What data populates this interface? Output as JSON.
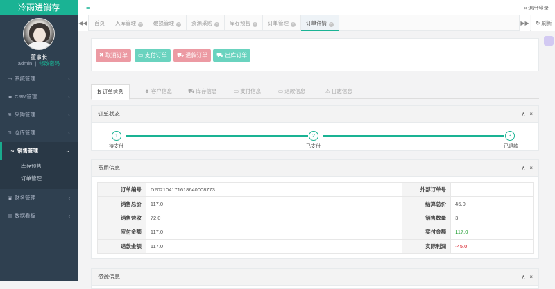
{
  "app": {
    "title": "冷雨进销存"
  },
  "user": {
    "role": "董事长",
    "name": "admin",
    "separator": "|",
    "change_password": "修改密码"
  },
  "sidebar": {
    "items": [
      {
        "label": "系统管理",
        "icon": "laptop-icon",
        "glyph": "▭"
      },
      {
        "label": "CRM管理",
        "icon": "users-icon",
        "glyph": "☻"
      },
      {
        "label": "采购管理",
        "icon": "cart-icon",
        "glyph": "⊞"
      },
      {
        "label": "仓库管理",
        "icon": "lock-icon",
        "glyph": "⊡"
      },
      {
        "label": "销售管理",
        "icon": "chart-line-icon",
        "glyph": "∿"
      },
      {
        "label": "财务管理",
        "icon": "money-icon",
        "glyph": "▣"
      },
      {
        "label": "数据看板",
        "icon": "bar-chart-icon",
        "glyph": "▥"
      }
    ],
    "sales_sub": [
      "库存预售",
      "订单管理"
    ]
  },
  "topbar": {
    "menu_icon": "≡",
    "logout": "退出登录",
    "logout_icon": "⇥"
  },
  "tabs": {
    "left_arrow": "◀◀",
    "items": [
      "首页",
      "入库管理",
      "破损管理",
      "资源采购",
      "库存预售",
      "订单管理",
      "订单详情"
    ],
    "active": "订单详情",
    "close_glyph": "×",
    "right_arrow": "▶▶",
    "refresh": "刷新",
    "refresh_glyph": "↻"
  },
  "actions": {
    "cancel": "取消订单",
    "cancel_glyph": "✖",
    "pay": "支付订单",
    "pay_glyph": "▭",
    "refund": "退款订单",
    "refund_glyph": "⛟",
    "outbound": "出库订单",
    "outbound_glyph": "⛟"
  },
  "subtabs": {
    "items": [
      {
        "label": "订单信息",
        "glyph": "₿"
      },
      {
        "label": "客户信息",
        "glyph": "☻"
      },
      {
        "label": "库存信息",
        "glyph": "⛟"
      },
      {
        "label": "支付信息",
        "glyph": "▭"
      },
      {
        "label": "退款信息",
        "glyph": "▭"
      },
      {
        "label": "日志信息",
        "glyph": "⚠"
      }
    ],
    "active": "订单信息"
  },
  "order_status": {
    "title": "订单状态",
    "steps": [
      {
        "num": "1",
        "label": "待支付"
      },
      {
        "num": "2",
        "label": "已支付"
      },
      {
        "num": "3",
        "label": "已退款"
      }
    ]
  },
  "panel_tools": {
    "collapse": "∧",
    "close": "×"
  },
  "fees": {
    "title": "费用信息",
    "rows": [
      {
        "l1": "订单编号",
        "v1": "D202104171618640008773",
        "l2": "外部订单号",
        "v2": ""
      },
      {
        "l1": "销售总价",
        "v1": "117.0",
        "l2": "结算总价",
        "v2": "45.0"
      },
      {
        "l1": "销售营收",
        "v1": "72.0",
        "l2": "销售数量",
        "v2": "3"
      },
      {
        "l1": "应付金额",
        "v1": "117.0",
        "l2": "实付金额",
        "v2": "117.0"
      },
      {
        "l1": "退款金额",
        "v1": "117.0",
        "l2": "实际利润",
        "v2": "-45.0"
      }
    ],
    "positive_color": "#1a9c2c",
    "negative_color": "#d9232d"
  },
  "resources": {
    "title": "资源信息"
  }
}
